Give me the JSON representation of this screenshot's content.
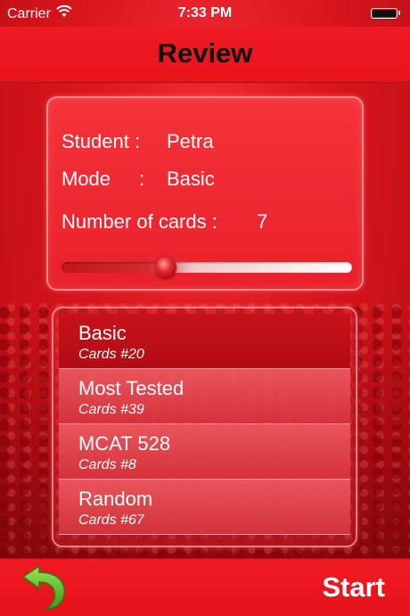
{
  "status_bar": {
    "carrier": "Carrier",
    "time": "7:33 PM",
    "wifi_icon": "wifi-icon",
    "battery_icon": "battery-icon"
  },
  "nav": {
    "title": "Review"
  },
  "info": {
    "student_label": "Student :",
    "student_value": "Petra",
    "mode_label": "Mode",
    "mode_colon": ":",
    "mode_value": "Basic",
    "cards_label": "Number of cards :",
    "cards_value": "7",
    "slider_fraction": 0.36
  },
  "decks": [
    {
      "title": "Basic",
      "subtitle": "Cards #20",
      "selected": true
    },
    {
      "title": "Most Tested",
      "subtitle": "Cards #39",
      "selected": false
    },
    {
      "title": "MCAT 528",
      "subtitle": "Cards #8",
      "selected": false
    },
    {
      "title": "Random",
      "subtitle": "Cards #67",
      "selected": false
    }
  ],
  "bottom": {
    "back_icon": "back-arrow-icon",
    "start_label": "Start"
  },
  "colors": {
    "primary_red": "#e9131b",
    "back_arrow_green": "#5fbf2a"
  }
}
